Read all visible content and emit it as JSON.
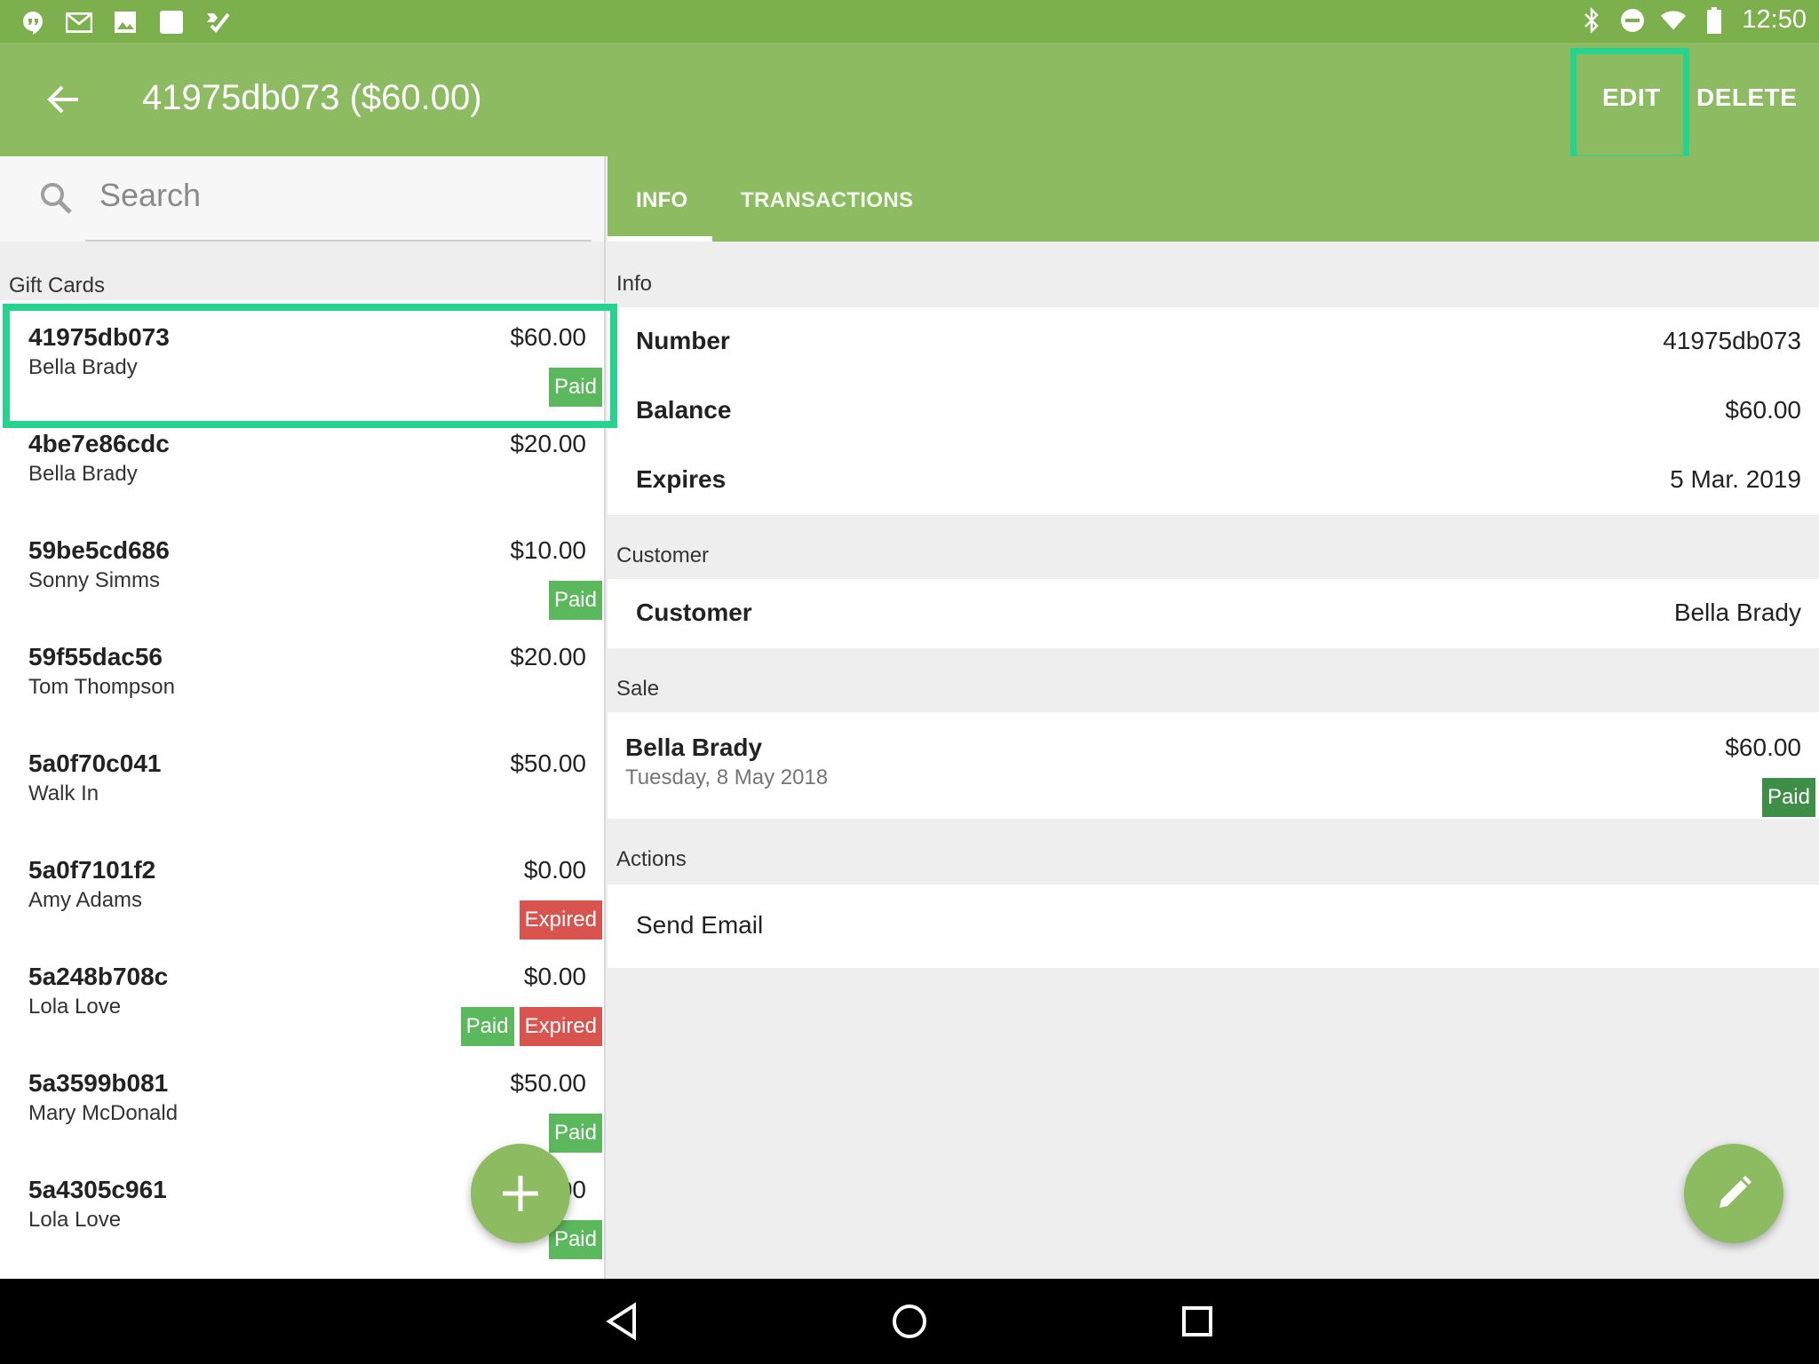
{
  "status_bar": {
    "time": "12:50",
    "left_icons": [
      "hangouts-icon",
      "gmail-icon",
      "photos-icon",
      "square-notification-icon",
      "tasks-icon"
    ],
    "right_icons": [
      "bluetooth-icon",
      "do-not-disturb-icon",
      "wifi-icon",
      "battery-icon"
    ]
  },
  "app_bar": {
    "title": "41975db073 ($60.00)",
    "edit_label": "EDIT",
    "delete_label": "DELETE"
  },
  "search": {
    "placeholder": "Search"
  },
  "list": {
    "header": "Gift Cards",
    "items": [
      {
        "number": "41975db073",
        "customer": "Bella Brady",
        "amount": "$60.00",
        "badges": [
          "Paid"
        ]
      },
      {
        "number": "4be7e86cdc",
        "customer": "Bella Brady",
        "amount": "$20.00",
        "badges": []
      },
      {
        "number": "59be5cd686",
        "customer": "Sonny Simms",
        "amount": "$10.00",
        "badges": [
          "Paid"
        ]
      },
      {
        "number": "59f55dac56",
        "customer": "Tom Thompson",
        "amount": "$20.00",
        "badges": []
      },
      {
        "number": "5a0f70c041",
        "customer": "Walk In",
        "amount": "$50.00",
        "badges": []
      },
      {
        "number": "5a0f7101f2",
        "customer": "Amy Adams",
        "amount": "$0.00",
        "badges": [
          "Expired"
        ]
      },
      {
        "number": "5a248b708c",
        "customer": "Lola Love",
        "amount": "$0.00",
        "badges": [
          "Paid",
          "Expired"
        ]
      },
      {
        "number": "5a3599b081",
        "customer": "Mary McDonald",
        "amount": "$50.00",
        "badges": [
          "Paid"
        ]
      },
      {
        "number": "5a4305c961",
        "customer": "Lola Love",
        "amount": "$50.00",
        "badges": [
          "Paid"
        ]
      }
    ]
  },
  "tabs": {
    "info": "INFO",
    "transactions": "TRANSACTIONS"
  },
  "detail": {
    "info_title": "Info",
    "number_label": "Number",
    "number_value": "41975db073",
    "balance_label": "Balance",
    "balance_value": "$60.00",
    "expires_label": "Expires",
    "expires_value": "5 Mar. 2019",
    "customer_title": "Customer",
    "customer_label": "Customer",
    "customer_value": "Bella Brady",
    "sale_title": "Sale",
    "sale_name": "Bella Brady",
    "sale_date": "Tuesday, 8 May 2018",
    "sale_amount": "$60.00",
    "sale_badge": "Paid",
    "actions_title": "Actions",
    "send_email": "Send Email"
  },
  "colors": {
    "status_bar": "#7cb04c",
    "app_bar": "#8cbb61",
    "highlight": "#25d38e",
    "paid": "#5cb85c",
    "expired": "#d9534f"
  }
}
